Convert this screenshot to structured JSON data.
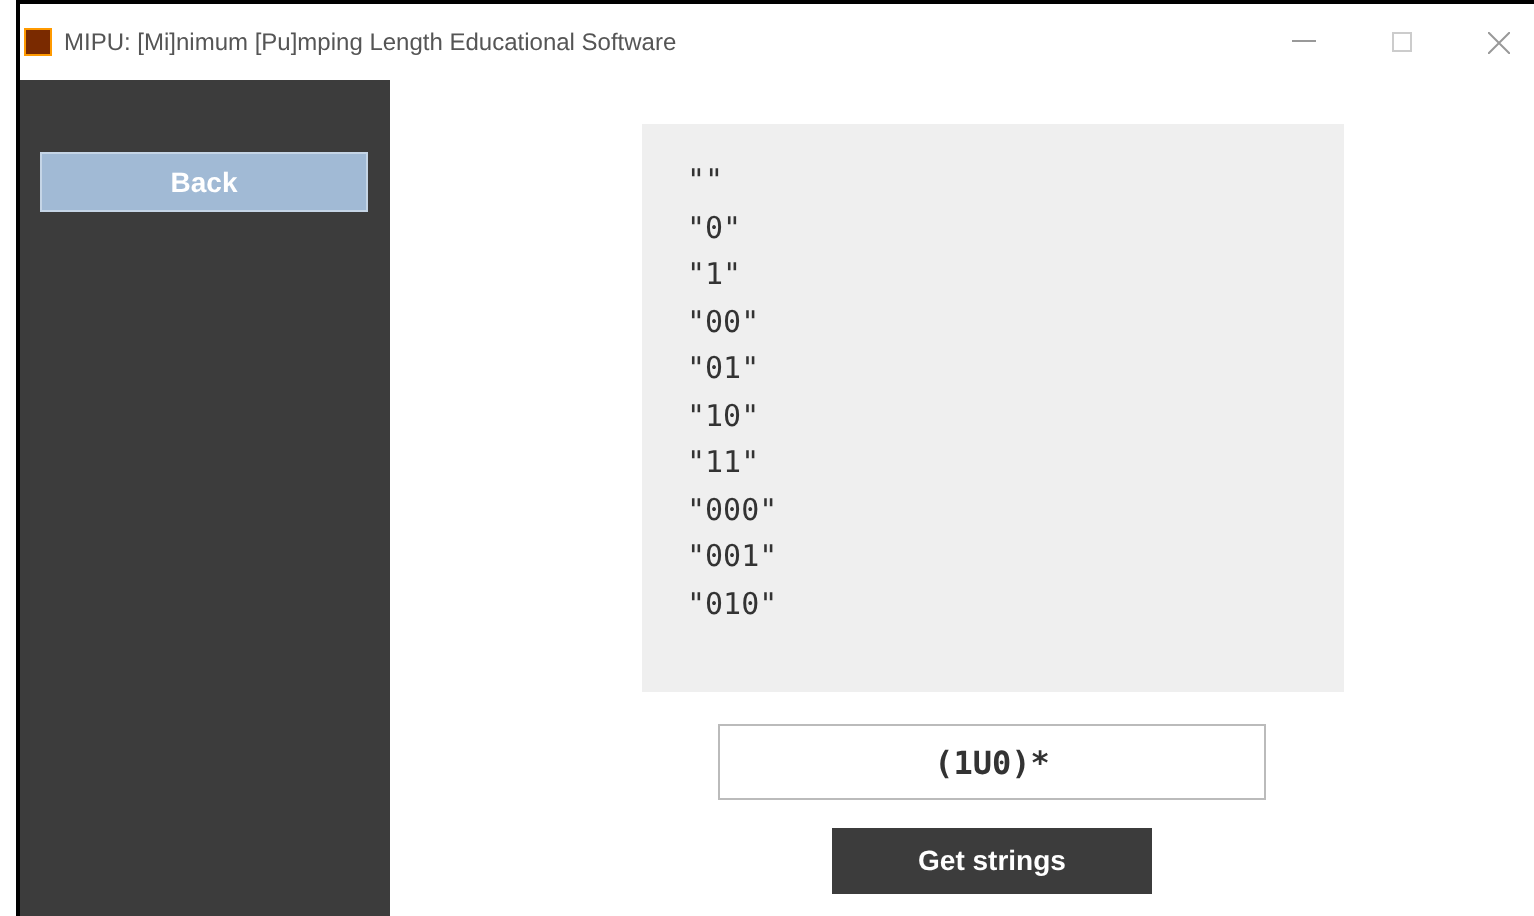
{
  "window": {
    "title": "MIPU: [Mi]nimum [Pu]mping Length Educational Software"
  },
  "sidebar": {
    "back_button": "Back"
  },
  "strings": [
    "\"\"",
    "\"0\"",
    "\"1\"",
    "\"00\"",
    "\"01\"",
    "\"10\"",
    "\"11\"",
    "\"000\"",
    "\"001\"",
    "\"010\""
  ],
  "expression_field": {
    "value": "(1U0)*"
  },
  "get_button": "Get strings"
}
